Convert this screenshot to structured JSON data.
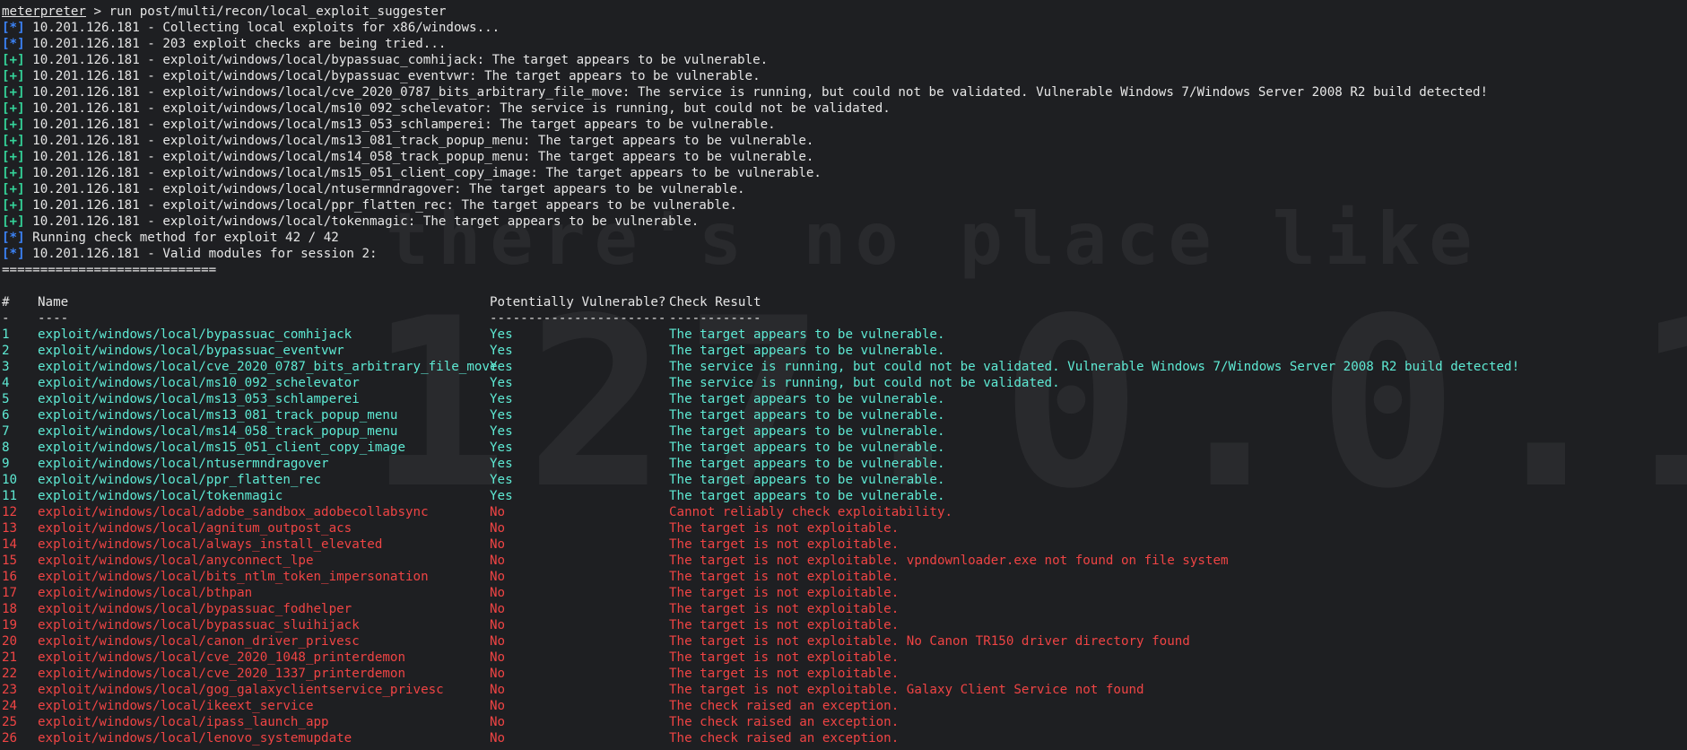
{
  "watermark": {
    "line1": "there's no place like",
    "line2": "127.0.0.1"
  },
  "colors": {
    "background": "#1e1f22",
    "info_tag": "#3b82f6",
    "good_tag": "#34d399",
    "vulnerable_row": "#5eead4",
    "not_vulnerable_row": "#ef4444"
  },
  "prompt": {
    "name": "meterpreter",
    "command": " > run post/multi/recon/local_exploit_suggester"
  },
  "log": [
    {
      "tag": "[*]",
      "type": "info",
      "text": " 10.201.126.181 - Collecting local exploits for x86/windows..."
    },
    {
      "tag": "[*]",
      "type": "info",
      "text": " 10.201.126.181 - 203 exploit checks are being tried..."
    },
    {
      "tag": "[+]",
      "type": "good",
      "text": " 10.201.126.181 - exploit/windows/local/bypassuac_comhijack: The target appears to be vulnerable."
    },
    {
      "tag": "[+]",
      "type": "good",
      "text": " 10.201.126.181 - exploit/windows/local/bypassuac_eventvwr: The target appears to be vulnerable."
    },
    {
      "tag": "[+]",
      "type": "good",
      "text": " 10.201.126.181 - exploit/windows/local/cve_2020_0787_bits_arbitrary_file_move: The service is running, but could not be validated. Vulnerable Windows 7/Windows Server 2008 R2 build detected!"
    },
    {
      "tag": "[+]",
      "type": "good",
      "text": " 10.201.126.181 - exploit/windows/local/ms10_092_schelevator: The service is running, but could not be validated."
    },
    {
      "tag": "[+]",
      "type": "good",
      "text": " 10.201.126.181 - exploit/windows/local/ms13_053_schlamperei: The target appears to be vulnerable."
    },
    {
      "tag": "[+]",
      "type": "good",
      "text": " 10.201.126.181 - exploit/windows/local/ms13_081_track_popup_menu: The target appears to be vulnerable."
    },
    {
      "tag": "[+]",
      "type": "good",
      "text": " 10.201.126.181 - exploit/windows/local/ms14_058_track_popup_menu: The target appears to be vulnerable."
    },
    {
      "tag": "[+]",
      "type": "good",
      "text": " 10.201.126.181 - exploit/windows/local/ms15_051_client_copy_image: The target appears to be vulnerable."
    },
    {
      "tag": "[+]",
      "type": "good",
      "text": " 10.201.126.181 - exploit/windows/local/ntusermndragover: The target appears to be vulnerable."
    },
    {
      "tag": "[+]",
      "type": "good",
      "text": " 10.201.126.181 - exploit/windows/local/ppr_flatten_rec: The target appears to be vulnerable."
    },
    {
      "tag": "[+]",
      "type": "good",
      "text": " 10.201.126.181 - exploit/windows/local/tokenmagic: The target appears to be vulnerable."
    },
    {
      "tag": "[*]",
      "type": "info",
      "text": " Running check method for exploit 42 / 42"
    },
    {
      "tag": "[*]",
      "type": "info",
      "text": " 10.201.126.181 - Valid modules for session 2:"
    }
  ],
  "separator": "============================",
  "table": {
    "headers": {
      "num": "#",
      "name": "Name",
      "vuln": "Potentially Vulnerable?",
      "check": "Check Result"
    },
    "underlines": {
      "num": "-",
      "name": "----",
      "vuln": "-----------------------",
      "check": "------------"
    },
    "rows": [
      {
        "num": "1",
        "name": "exploit/windows/local/bypassuac_comhijack",
        "vuln": "Yes",
        "check": "The target appears to be vulnerable."
      },
      {
        "num": "2",
        "name": "exploit/windows/local/bypassuac_eventvwr",
        "vuln": "Yes",
        "check": "The target appears to be vulnerable."
      },
      {
        "num": "3",
        "name": "exploit/windows/local/cve_2020_0787_bits_arbitrary_file_move",
        "vuln": "Yes",
        "check": "The service is running, but could not be validated. Vulnerable Windows 7/Windows Server 2008 R2 build detected!"
      },
      {
        "num": "4",
        "name": "exploit/windows/local/ms10_092_schelevator",
        "vuln": "Yes",
        "check": "The service is running, but could not be validated."
      },
      {
        "num": "5",
        "name": "exploit/windows/local/ms13_053_schlamperei",
        "vuln": "Yes",
        "check": "The target appears to be vulnerable."
      },
      {
        "num": "6",
        "name": "exploit/windows/local/ms13_081_track_popup_menu",
        "vuln": "Yes",
        "check": "The target appears to be vulnerable."
      },
      {
        "num": "7",
        "name": "exploit/windows/local/ms14_058_track_popup_menu",
        "vuln": "Yes",
        "check": "The target appears to be vulnerable."
      },
      {
        "num": "8",
        "name": "exploit/windows/local/ms15_051_client_copy_image",
        "vuln": "Yes",
        "check": "The target appears to be vulnerable."
      },
      {
        "num": "9",
        "name": "exploit/windows/local/ntusermndragover",
        "vuln": "Yes",
        "check": "The target appears to be vulnerable."
      },
      {
        "num": "10",
        "name": "exploit/windows/local/ppr_flatten_rec",
        "vuln": "Yes",
        "check": "The target appears to be vulnerable."
      },
      {
        "num": "11",
        "name": "exploit/windows/local/tokenmagic",
        "vuln": "Yes",
        "check": "The target appears to be vulnerable."
      },
      {
        "num": "12",
        "name": "exploit/windows/local/adobe_sandbox_adobecollabsync",
        "vuln": "No",
        "check": "Cannot reliably check exploitability."
      },
      {
        "num": "13",
        "name": "exploit/windows/local/agnitum_outpost_acs",
        "vuln": "No",
        "check": "The target is not exploitable."
      },
      {
        "num": "14",
        "name": "exploit/windows/local/always_install_elevated",
        "vuln": "No",
        "check": "The target is not exploitable."
      },
      {
        "num": "15",
        "name": "exploit/windows/local/anyconnect_lpe",
        "vuln": "No",
        "check": "The target is not exploitable. vpndownloader.exe not found on file system"
      },
      {
        "num": "16",
        "name": "exploit/windows/local/bits_ntlm_token_impersonation",
        "vuln": "No",
        "check": "The target is not exploitable."
      },
      {
        "num": "17",
        "name": "exploit/windows/local/bthpan",
        "vuln": "No",
        "check": "The target is not exploitable."
      },
      {
        "num": "18",
        "name": "exploit/windows/local/bypassuac_fodhelper",
        "vuln": "No",
        "check": "The target is not exploitable."
      },
      {
        "num": "19",
        "name": "exploit/windows/local/bypassuac_sluihijack",
        "vuln": "No",
        "check": "The target is not exploitable."
      },
      {
        "num": "20",
        "name": "exploit/windows/local/canon_driver_privesc",
        "vuln": "No",
        "check": "The target is not exploitable. No Canon TR150 driver directory found"
      },
      {
        "num": "21",
        "name": "exploit/windows/local/cve_2020_1048_printerdemon",
        "vuln": "No",
        "check": "The target is not exploitable."
      },
      {
        "num": "22",
        "name": "exploit/windows/local/cve_2020_1337_printerdemon",
        "vuln": "No",
        "check": "The target is not exploitable."
      },
      {
        "num": "23",
        "name": "exploit/windows/local/gog_galaxyclientservice_privesc",
        "vuln": "No",
        "check": "The target is not exploitable. Galaxy Client Service not found"
      },
      {
        "num": "24",
        "name": "exploit/windows/local/ikeext_service",
        "vuln": "No",
        "check": "The check raised an exception."
      },
      {
        "num": "25",
        "name": "exploit/windows/local/ipass_launch_app",
        "vuln": "No",
        "check": "The check raised an exception."
      },
      {
        "num": "26",
        "name": "exploit/windows/local/lenovo_systemupdate",
        "vuln": "No",
        "check": "The check raised an exception."
      }
    ]
  }
}
